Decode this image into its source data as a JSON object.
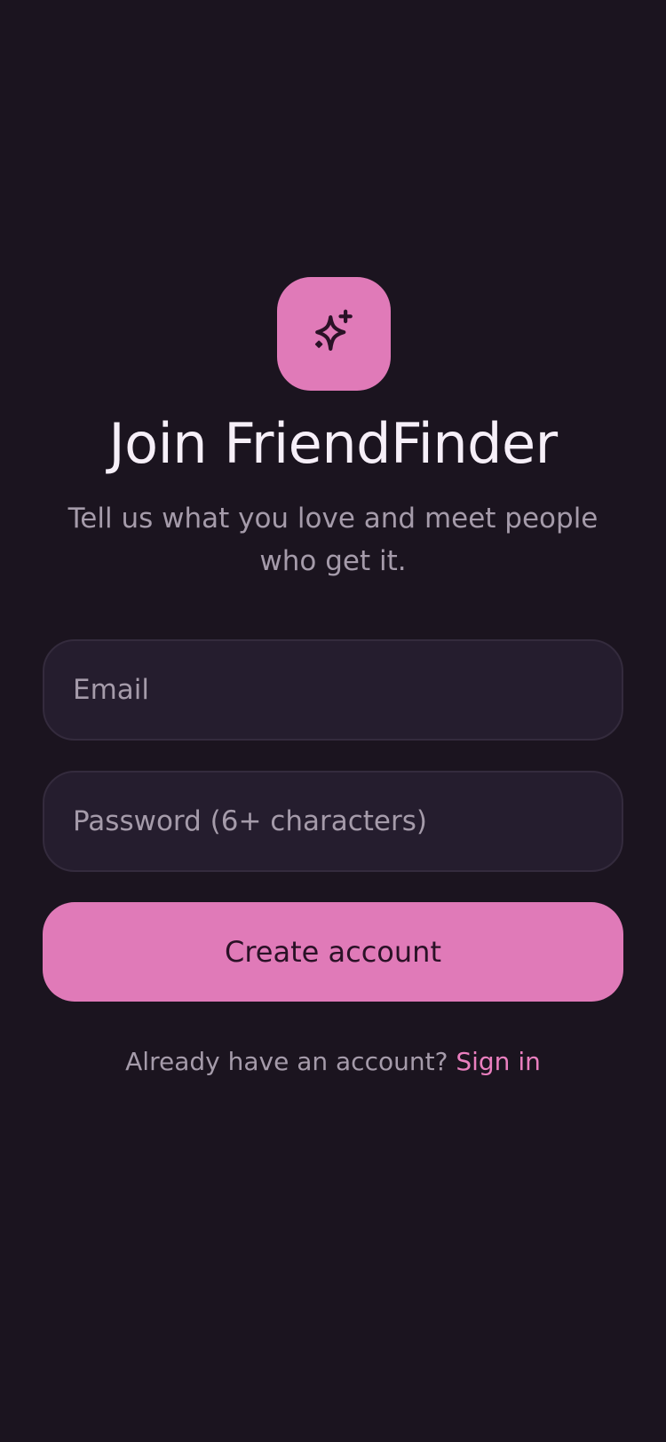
{
  "app": {
    "name": "FriendFinder"
  },
  "logo": {
    "icon": "sparkles-icon",
    "tile_color": "#e07ab8"
  },
  "header": {
    "title": "Join FriendFinder",
    "subtitle": "Tell us what you love and meet people who get it."
  },
  "form": {
    "email": {
      "value": "",
      "placeholder": "Email"
    },
    "password": {
      "value": "",
      "placeholder": "Password (6+ characters)"
    },
    "submit_label": "Create account"
  },
  "footer": {
    "prompt": "Already have an account?",
    "link_label": "Sign in"
  },
  "colors": {
    "background": "#1b141f",
    "accent": "#e07ab8",
    "field_background": "#251d2e",
    "muted_text": "#a59baa"
  }
}
